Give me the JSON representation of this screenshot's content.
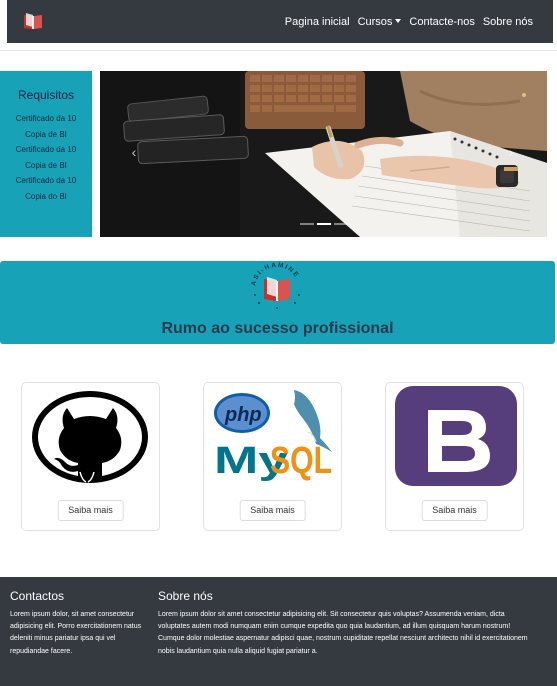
{
  "navbar": {
    "brand_icon": "book-logo-icon",
    "links": [
      {
        "label": "Pagina inicial"
      },
      {
        "label": "Cursos",
        "has_dropdown": true
      },
      {
        "label": "Contacte-nos"
      },
      {
        "label": "Sobre nós"
      }
    ]
  },
  "requisitos": {
    "title": "Requisitos",
    "items": [
      "Certificado da 10",
      "Copia de BI",
      "Certificado da 10",
      "Copia de BI",
      "Certificado da 10",
      "Copia do BI"
    ]
  },
  "carousel": {
    "image": "hands-writing-in-planner-photo",
    "prev_icon": "chevron-left-icon",
    "next_icon": "chevron-right-icon",
    "slides": 3,
    "active_slide": 2
  },
  "banner": {
    "logo_text": "ASI-HAMINE",
    "title": "Rumo ao sucesso profissional"
  },
  "cards": [
    {
      "image": "github-logo-image",
      "button": "Saiba mais"
    },
    {
      "image": "php-mysql-logo-image",
      "button": "Saiba mais"
    },
    {
      "image": "bootstrap-logo-image",
      "button": "Saiba mais"
    }
  ],
  "footer": {
    "contactos_title": "Contactos",
    "contactos_text": "Lorem ipsum dolor, sit amet consectetur adipisicing elit. Porro exercitationem natus deleniti minus pariatur ipsa qui vel repudiandae facere.",
    "sobre_title": "Sobre nós",
    "sobre_text": "Lorem ipsum dolor sit amet consectetur adipisicing elit. Sit consectetur quis voluptas? Assumenda veniam, dicta voluptates autem modi numquam enim cumque expedita quo quia laudantium, ad illum quisquam harum nostrum! Cumque dolor molestiae aspernatur adipisci quae, nostrum cupiditate repellat nesciunt architecto nihil id exercitationem nobis laudantium quia nulla aliquid fugiat pariatur a."
  },
  "colors": {
    "navbar": "#343a40",
    "accent": "#17a2b8",
    "footer": "#343a40"
  }
}
